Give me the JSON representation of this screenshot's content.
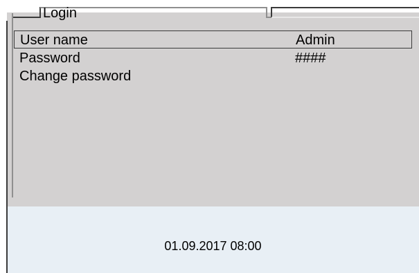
{
  "tab": {
    "title": "Login"
  },
  "menu": {
    "items": [
      {
        "label": "User name",
        "value": "Admin"
      },
      {
        "label": "Password",
        "value": "####"
      },
      {
        "label": "Change password",
        "value": ""
      }
    ]
  },
  "status": {
    "datetime": "01.09.2017 08:00"
  },
  "colors": {
    "panel": "#d3d1d1",
    "status_area": "#e8eff5",
    "frame": "#3a3a3a"
  }
}
